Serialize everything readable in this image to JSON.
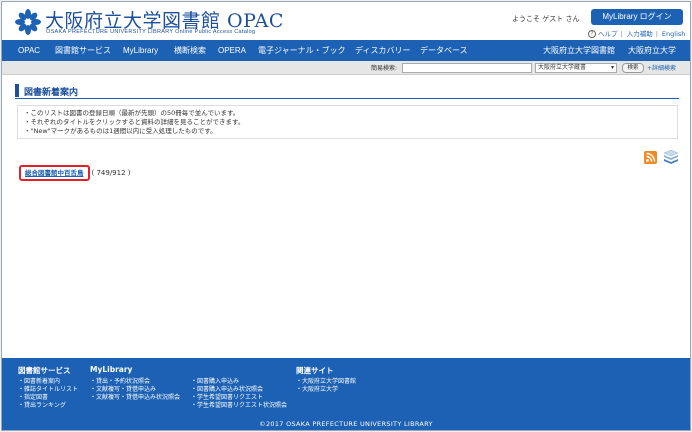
{
  "header": {
    "title": "大阪府立大学図書館 OPAC",
    "subtitle": "OSAKA PREFECTURE UNIVERSITY LIBRARY  Online Public Access Catalog",
    "welcome": "ようこそ  ゲスト さん",
    "login_label": "MyLibrary ログイン",
    "help_label": "ヘルプ",
    "input_help_label": "入力補助",
    "english_label": "English"
  },
  "nav": {
    "items": [
      "OPAC",
      "図書館サービス",
      "MyLibrary",
      "横断検索",
      "OPERA",
      "電子ジャーナル・ブック",
      "ディスカバリー",
      "データベース"
    ],
    "right_items": [
      "大阪府立大学図書館",
      "大阪府立大学"
    ]
  },
  "search": {
    "label": "簡易検索:",
    "value": "",
    "scope_selected": "大阪府立大学蔵書",
    "button_label": "検索",
    "advanced_label": "+詳細検索"
  },
  "page": {
    "title": "図書新着案内",
    "info_lines": [
      "・このリストは図書の登録日順（最新が先頭）の50冊毎で並んでいます。",
      "・それぞれのタイトルをクリックすると資料の詳細を見ることができます。",
      "・\"New\"マークがあるものは1週間以内に受入処理したものです。"
    ],
    "result_link": "総合図書館中百舌鳥",
    "result_count": "( 749/912 )"
  },
  "footer": {
    "col1_title": "図書館サービス",
    "col1_links": [
      "・図書新着案内",
      "・雑誌タイトルリスト",
      "・指定図書",
      "・貸出ランキング"
    ],
    "col2_title": "MyLibrary",
    "col2_links": [
      "・貸出・予約状況照会",
      "・文献複写・貸借申込み",
      "・文献複写・貸借申込み状況照会"
    ],
    "col3_links": [
      "・図書購入申込み",
      "・図書購入申込み状況照会",
      "・学生希望図書リクエスト",
      "・学生希望図書リクエスト状況照会"
    ],
    "col4_title": "関連サイト",
    "col4_links": [
      "・大阪府立大学図書館",
      "・大阪府立大学"
    ],
    "copyright": "©2017 OSAKA PREFECTURE UNIVERSITY LIBRARY"
  },
  "icons": {
    "rss": "rss-icon",
    "feed": "stack-icon",
    "logo": "university-logo-icon"
  },
  "colors": {
    "brand_blue": "#1c61b4",
    "title_blue": "#1c4f9c",
    "highlight_red": "#e0202a",
    "rss_orange": "#f08a24"
  }
}
